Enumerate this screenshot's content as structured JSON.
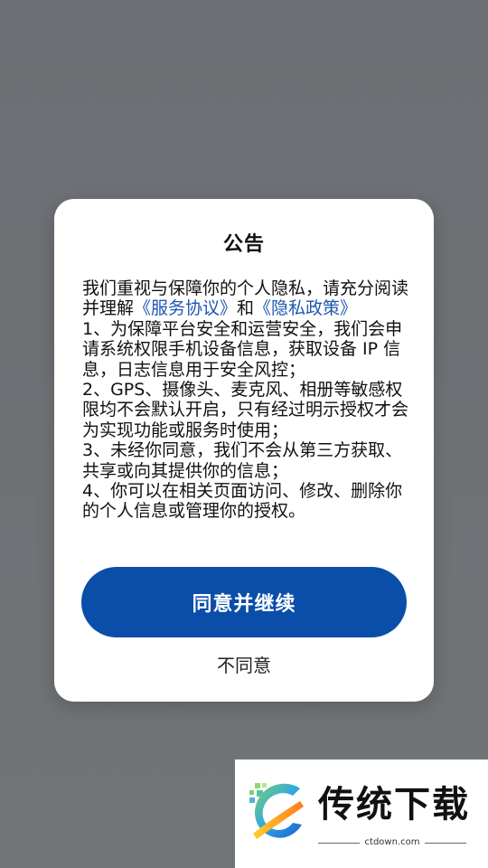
{
  "dialog": {
    "title": "公告",
    "intro_prefix": "我们重视与保障你的个人隐私，请充分阅读并理解",
    "service_link": "《服务协议》",
    "intro_and": "和",
    "privacy_link": "《隐私政策》",
    "items": [
      "1、为保障平台安全和运营安全，我们会申请系统权限手机设备信息，获取设备 IP 信息，日志信息用于安全风控；",
      "2、GPS、摄像头、麦克风、相册等敏感权限均不会默认开启，只有经过明示授权才会为实现功能或服务时使用；",
      "3、未经你同意，我们不会从第三方获取、共享或向其提供你的信息；",
      "4、你可以在相关页面访问、修改、删除你的个人信息或管理你的授权。"
    ],
    "agree_label": "同意并继续",
    "disagree_label": "不同意"
  },
  "watermark": {
    "brand": "传统下载",
    "url": "ctdown.com"
  },
  "colors": {
    "overlay": "#6e7175",
    "accent": "#0b4ea9",
    "link": "#1d57b0"
  }
}
